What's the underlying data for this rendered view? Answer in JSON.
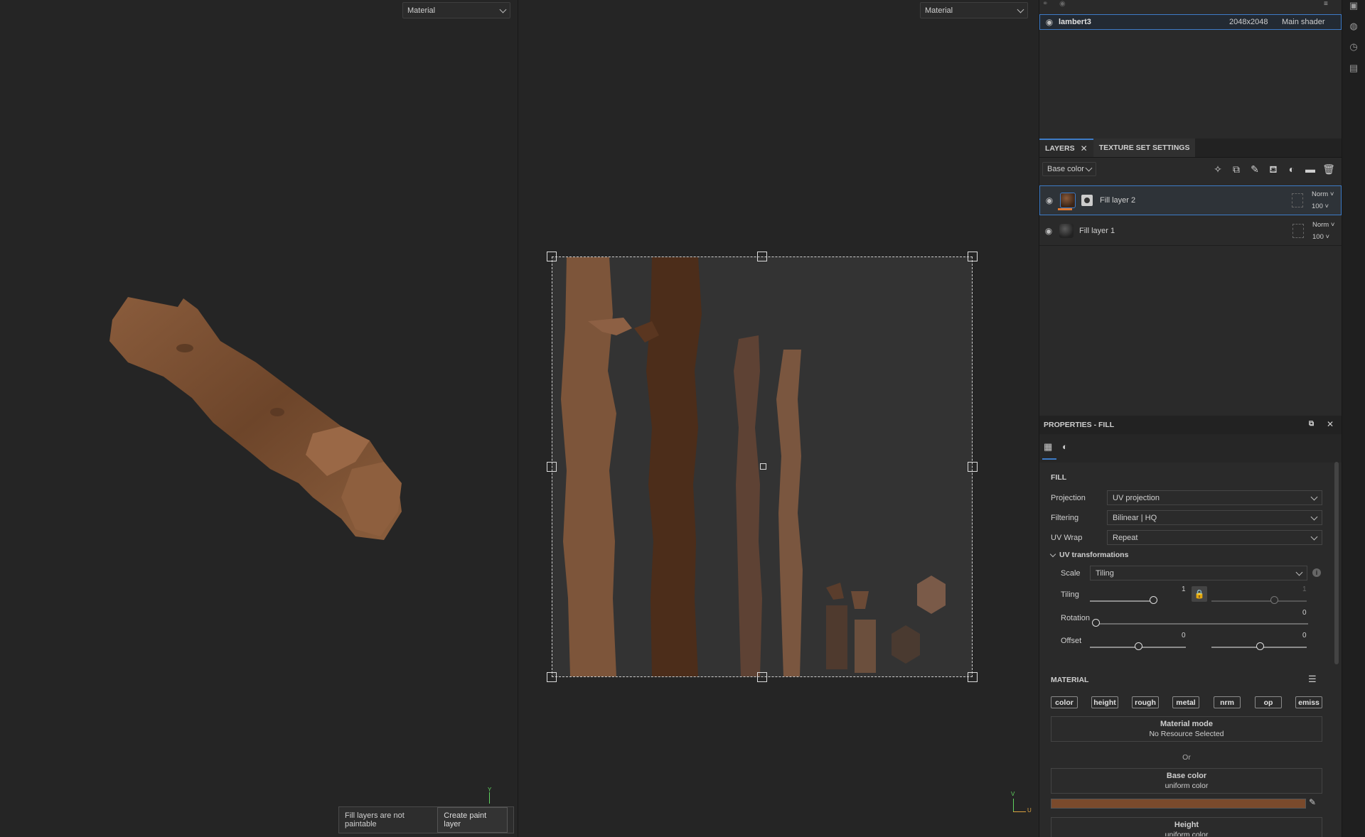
{
  "viewport_left": {
    "mode": "Material"
  },
  "viewport_right": {
    "mode": "Material"
  },
  "toast": {
    "message": "Fill layers are not paintable",
    "button": "Create paint layer"
  },
  "texture_set": {
    "name": "lambert3",
    "size": "2048x2048",
    "shader": "Main shader"
  },
  "layers_panel": {
    "tabs": [
      "LAYERS",
      "TEXTURE SET SETTINGS"
    ],
    "channel": "Base color",
    "layers": [
      {
        "name": "Fill layer 2",
        "blend": "Norm",
        "opacity": "100"
      },
      {
        "name": "Fill layer 1",
        "blend": "Norm",
        "opacity": "100"
      }
    ]
  },
  "properties": {
    "title": "PROPERTIES - FILL",
    "section_fill": "FILL",
    "projection_label": "Projection",
    "projection_value": "UV projection",
    "filtering_label": "Filtering",
    "filtering_value": "Bilinear | HQ",
    "uvwrap_label": "UV Wrap",
    "uvwrap_value": "Repeat",
    "uvtrans_label": "UV transformations",
    "scale_label": "Scale",
    "scale_value": "Tiling",
    "tiling_label": "Tiling",
    "tiling_u": "1",
    "tiling_v": "1",
    "rotation_label": "Rotation",
    "rotation_value": "0",
    "offset_label": "Offset",
    "offset_u": "0",
    "offset_v": "0",
    "section_material": "MATERIAL",
    "channels": [
      "color",
      "height",
      "rough",
      "metal",
      "nrm",
      "op",
      "emiss"
    ],
    "material_mode_title": "Material mode",
    "material_mode_value": "No Resource Selected",
    "or": "Or",
    "base_color_title": "Base color",
    "base_color_sub": "uniform color",
    "base_color_hex": "#7a4a2c",
    "height_title": "Height",
    "height_sub": "uniform color"
  },
  "axes": {
    "y": "Y",
    "u": "U",
    "v": "V"
  }
}
